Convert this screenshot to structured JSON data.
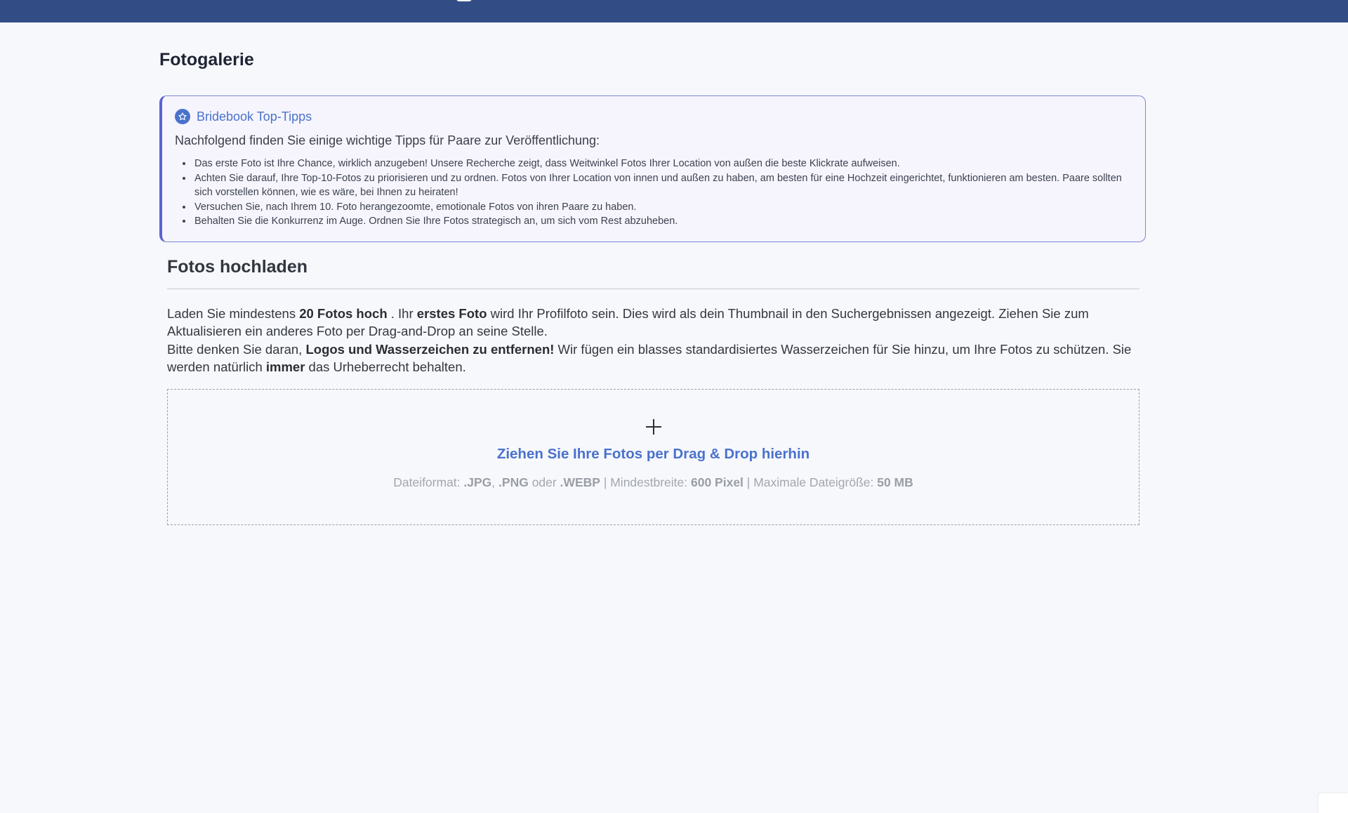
{
  "page": {
    "title": "Fotogalerie"
  },
  "tips": {
    "icon": "star-icon",
    "title": "Bridebook Top-Tipps",
    "intro": "Nachfolgend finden Sie einige wichtige Tipps für Paare zur Veröffentlichung:",
    "items": [
      "Das erste Foto ist Ihre Chance, wirklich anzugeben! Unsere Recherche zeigt, dass Weitwinkel Fotos Ihrer Location von außen die beste Klickrate aufweisen.",
      "Achten Sie darauf, Ihre Top-10-Fotos zu priorisieren und zu ordnen. Fotos von Ihrer Location von innen und außen zu haben, am besten für eine Hochzeit eingerichtet, funktionieren am besten. Paare sollten sich vorstellen können, wie es wäre, bei Ihnen zu heiraten!",
      "Versuchen Sie, nach Ihrem 10. Foto herangezoomte, emotionale Fotos von ihren Paare zu haben.",
      "Behalten Sie die Konkurrenz im Auge. Ordnen Sie Ihre Fotos strategisch an, um sich vom Rest abzuheben."
    ]
  },
  "upload": {
    "title": "Fotos hochladen",
    "desc": {
      "p1_a": "Laden Sie mindestens ",
      "p1_b": "20 Fotos hoch",
      "p1_c": " . Ihr ",
      "p1_d": "erstes Foto",
      "p1_e": " wird Ihr Profilfoto sein. Dies wird als dein Thumbnail in den Suchergebnissen angezeigt. Ziehen Sie zum Aktualisieren ein anderes Foto per Drag-and-Drop an seine Stelle.",
      "p2_a": "Bitte denken Sie daran, ",
      "p2_b": "Logos und Wasserzeichen zu entfernen!",
      "p2_c": " Wir fügen ein blasses standardisiertes Wasserzeichen für Sie hinzu, um Ihre Fotos zu schützen. Sie werden natürlich ",
      "p2_d": "immer",
      "p2_e": " das Urheberrecht behalten."
    },
    "dropzone": {
      "icon": "plus-icon",
      "cta": "Ziehen Sie Ihre Fotos per Drag & Drop hierhin",
      "info": {
        "a": "Dateiformat: ",
        "b": ".JPG",
        "c": ", ",
        "d": ".PNG",
        "e": " oder ",
        "f": ".WEBP",
        "g": " | Mindestbreite: ",
        "h": "600 Pixel",
        "i": " | Maximale Dateigröße: ",
        "j": "50 MB"
      }
    }
  },
  "colors": {
    "topbar": "#324c85",
    "accent": "#4a72cc",
    "tips_border": "#5b63cf"
  }
}
